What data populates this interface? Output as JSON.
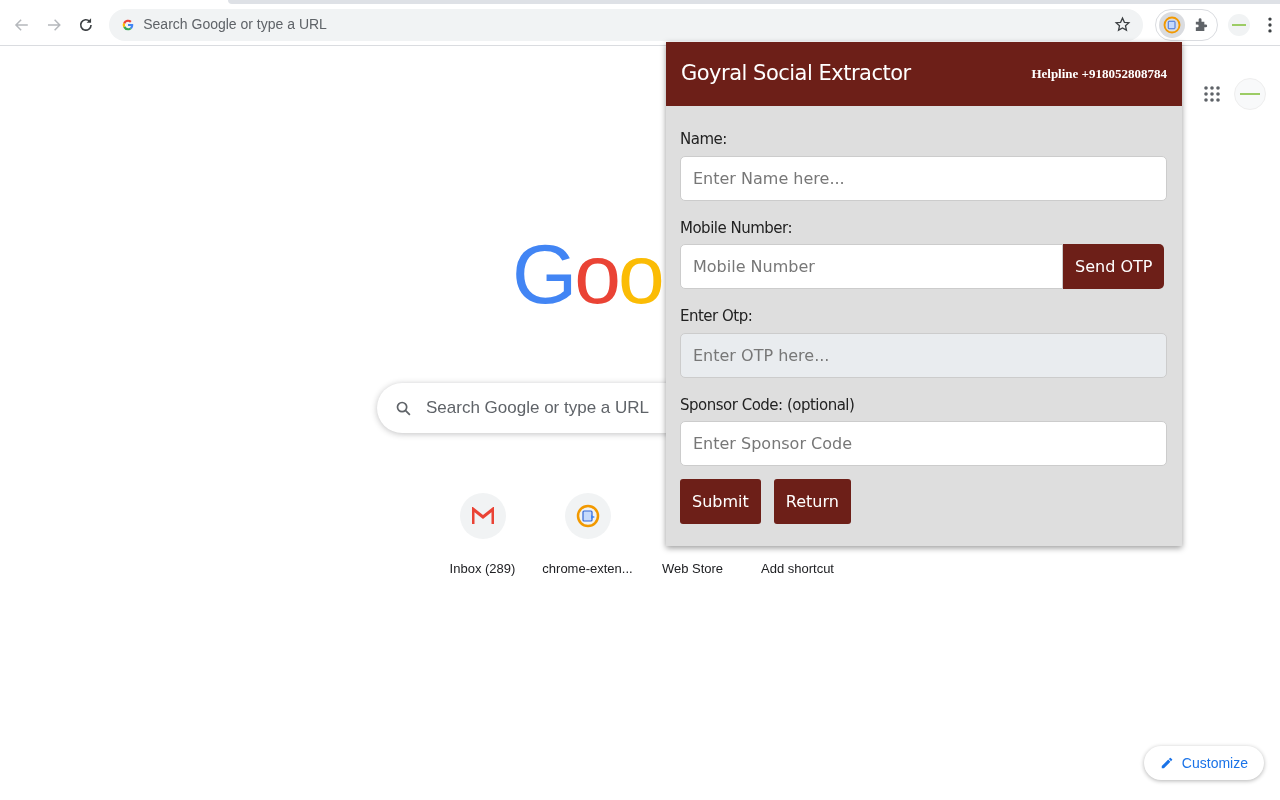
{
  "browser": {
    "omnibox_placeholder": "Search Google or type a URL"
  },
  "page": {
    "logo": "Goo",
    "search_placeholder": "Search Google or type a URL",
    "shortcuts": [
      {
        "label": "Inbox (289)",
        "kind": "mail"
      },
      {
        "label": "chrome-exten...",
        "kind": "extension"
      },
      {
        "label": "Web Store",
        "kind": "hidden"
      },
      {
        "label": "Add shortcut",
        "kind": "hidden"
      }
    ],
    "customize": "Customize"
  },
  "popup": {
    "title": "Goyral Social Extractor",
    "helpline": "Helpline +918052808784",
    "fields": [
      {
        "label": "Name:",
        "placeholder": "Enter Name here...",
        "disabled": false
      },
      {
        "label": "Mobile Number:",
        "placeholder": "Mobile Number",
        "disabled": false,
        "button": "Send OTP"
      },
      {
        "label": "Enter Otp:",
        "placeholder": "Enter OTP here...",
        "disabled": true
      },
      {
        "label": "Sponsor Code: (optional)",
        "placeholder": "Enter Sponsor Code",
        "disabled": false
      }
    ],
    "buttons": [
      "Submit",
      "Return"
    ]
  }
}
